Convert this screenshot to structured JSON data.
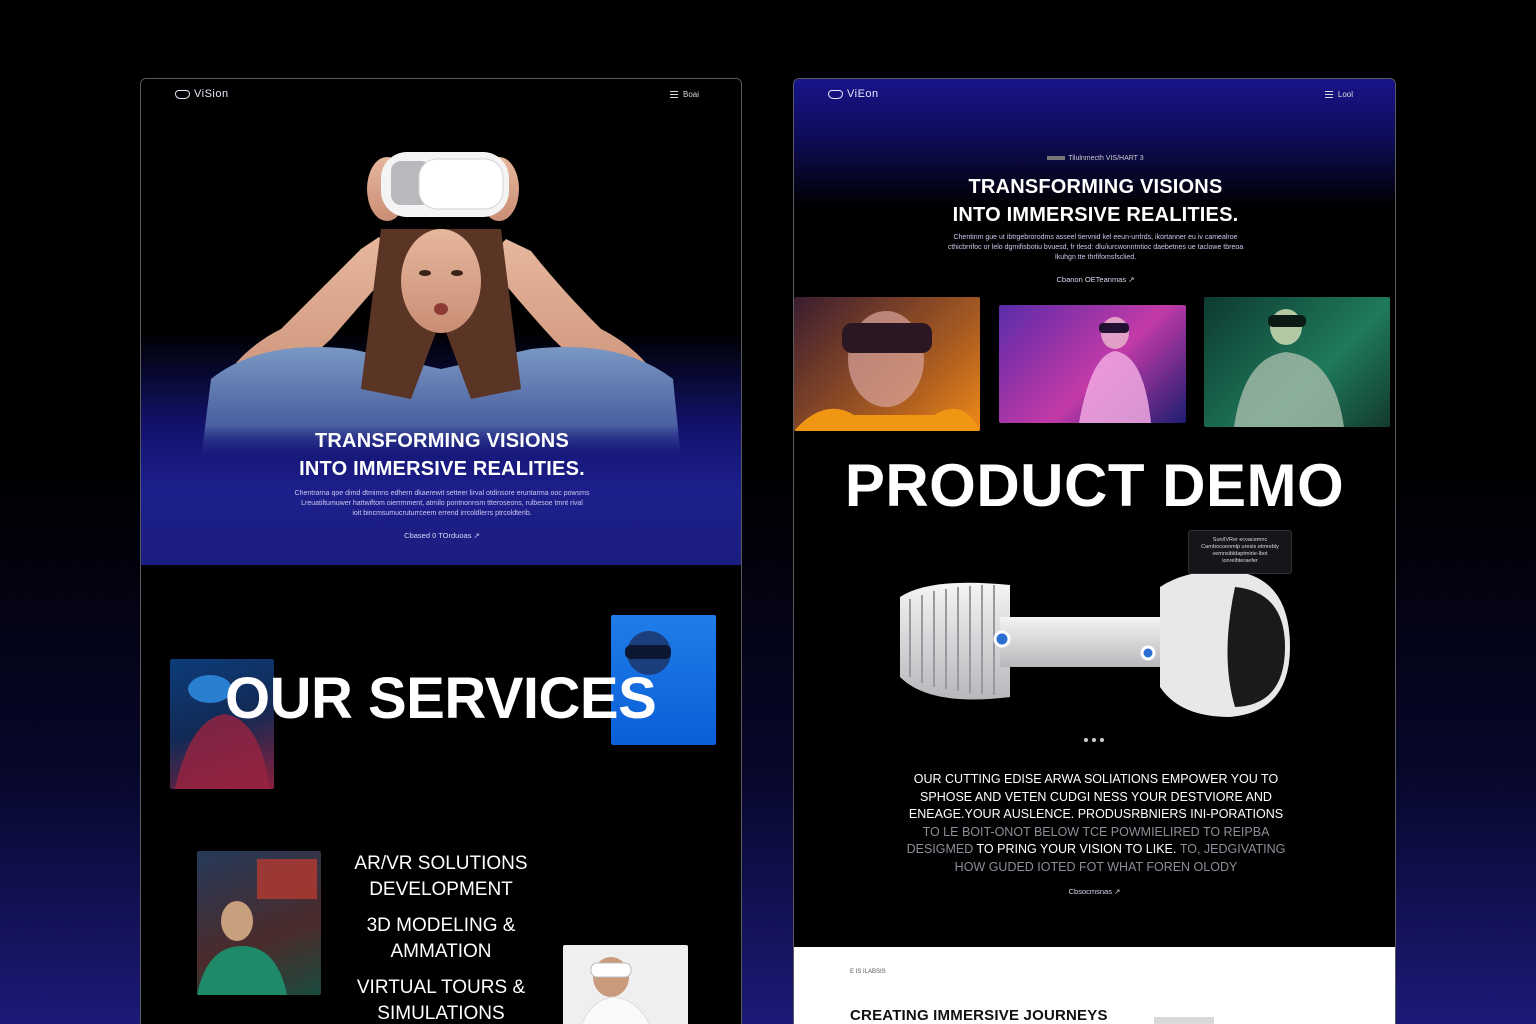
{
  "left_page": {
    "nav": {
      "logo": "ViSion",
      "menu": "Boai"
    },
    "hero": {
      "title_line1": "TRANSFORMING VISIONS",
      "title_line2": "INTO IMMERSIVE REALITIES.",
      "body_line1": "Chentrarna qoe dimd dtmimns edhern dkaerewit setteer lirval otdinsore eruntarma ooc powsms",
      "body_line2": "Lreuatiltumuwer hattwiftom oierrmment, atmilo pontnonnsm ttteroseons, rulbesoe tmnt rival",
      "body_line3": "ioit bincmsumucruturrceem errend irrcoldlerrs ptrcoldterib.",
      "cta": "Cbased 0 TOrduoas"
    },
    "services": {
      "title": "OUR SERVICES",
      "items": [
        "AR/VR SOLUTIONS DEVELOPMENT",
        "3D MODELING & AMMATION",
        "VIRTUAL TOURS & SIMULATIONS"
      ]
    }
  },
  "right_page": {
    "nav": {
      "logo": "ViEon",
      "menu": "Lool"
    },
    "hero": {
      "eyebrow": "Tilulnmecth VIS/HART 3",
      "title_line1": "TRANSFORMING VISIONS",
      "title_line2": "INTO IMMERSIVE REALITIES.",
      "body_line1": "Chentinm gue ut ibtrgebrorodms asseel tiervnid kel eeun-urrlrds, ikortanner eu iv camealroe",
      "body_line2": "cthicbrrifoc or lelo dgmifisbotiu bvuesd, fr tlesd: dlu/iurcwonntntioc daebetnes ue taclowe tbreoa",
      "body_line3": "Ikuhgn tte thrfifomsfsclied.",
      "cta": "Cbanon OETeanmas"
    },
    "demo": {
      "title": "PRODUCT DEMO",
      "tooltip_line1": "Sun/lVRer ecvacemnc",
      "tooltip_line2": "Carnbocoeomlp uresis etmrebly",
      "tooltip_line3": "vemnsibldaptmirie-lbot",
      "tooltip_line4": "ionrelbteraefer",
      "desc_line1": "OUR CUTTING EDISE ARWA SOLIATIONS EMPOWER YOU TO",
      "desc_line2": "SPHOSE AND VETEN CUDGI NESS YOUR DESTVIORE AND",
      "desc_line3": "ENEAGE.YOUR AUSLENCE. PRODUSRBNIERS INI-PORATIONS",
      "desc_line4": "TO LE BOIT-ONOT BELOW TCE POWMIELIRED TO REIPBA",
      "desc_line5a": "DESIGMED",
      "desc_line5b": "TO PRING YOUR VISION TO LIKE.",
      "desc_line5c": "TO, JEDGIVATING",
      "desc_line6": "HOW GUDED IOTED FOT WHAT FOREN OLODY",
      "cta": "Cbsocmsnas"
    },
    "next_section": {
      "eyebrow": "E IS ILABSIS",
      "title": "CREATING IMMERSIVE JOURNEYS"
    }
  },
  "colors": {
    "accent_blue": "#1d1f8c",
    "bg": "#000000",
    "text": "#ffffff"
  }
}
